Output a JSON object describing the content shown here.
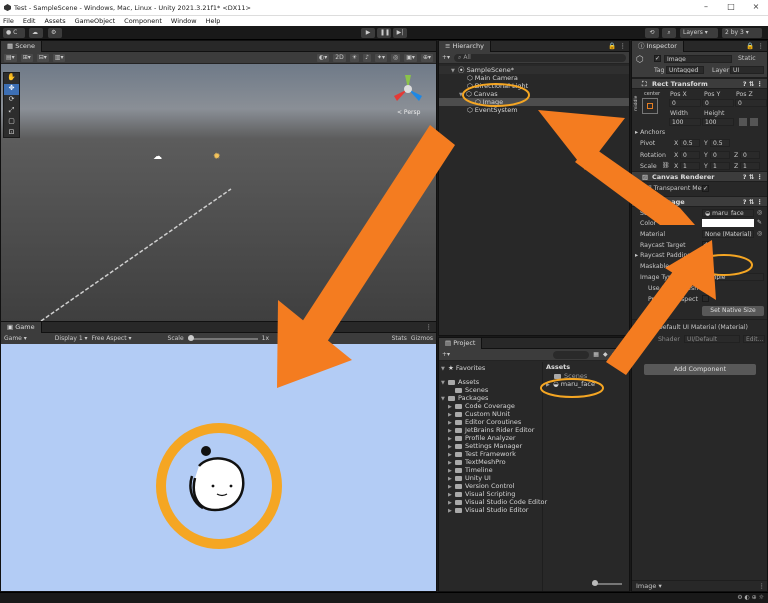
{
  "window": {
    "title": "Test - SampleScene - Windows, Mac, Linux - Unity 2021.3.21f1* <DX11>"
  },
  "menu": [
    "File",
    "Edit",
    "Assets",
    "GameObject",
    "Component",
    "Window",
    "Help"
  ],
  "toolbar": {
    "account": "C",
    "layers": "Layers",
    "layout": "2 by 3"
  },
  "scene": {
    "tab": "Scene",
    "mode_2d": "2D",
    "persp": "< Persp"
  },
  "game": {
    "tab": "Game",
    "display_mode": "Game",
    "display": "Display 1",
    "aspect": "Free Aspect",
    "scale_label": "Scale",
    "scale_value": "1x",
    "stats": "Stats",
    "gizmos": "Gizmos"
  },
  "hierarchy": {
    "tab": "Hierarchy",
    "search": "All",
    "items": [
      "SampleScene*",
      "Main Camera",
      "Directional Light",
      "Canvas",
      "Image",
      "EventSystem"
    ]
  },
  "project": {
    "tab": "Project",
    "favorites": "Favorites",
    "assets_folder": "Assets",
    "scenes": "Scenes",
    "packages": "Packages",
    "package_items": [
      "Code Coverage",
      "Custom NUnit",
      "Editor Coroutines",
      "JetBrains Rider Editor",
      "Profile Analyzer",
      "Settings Manager",
      "Test Framework",
      "TextMeshPro",
      "Timeline",
      "Unity UI",
      "Version Control",
      "Visual Scripting",
      "Visual Studio Code Editor",
      "Visual Studio Editor"
    ],
    "breadcrumb": "Assets",
    "asset_items": [
      "Scenes",
      "maru_face"
    ]
  },
  "inspector": {
    "tab": "Inspector",
    "object_name": "Image",
    "static": "Static",
    "tag_label": "Tag",
    "tag_value": "Untagged",
    "layer_label": "Layer",
    "layer_value": "UI",
    "rect_transform": {
      "title": "Rect Transform",
      "anchor": "center",
      "anchor_side": "middle",
      "pos_x_label": "Pos X",
      "pos_y_label": "Pos Y",
      "pos_z_label": "Pos Z",
      "pos_x": "0",
      "pos_y": "0",
      "pos_z": "0",
      "width_label": "Width",
      "height_label": "Height",
      "width": "100",
      "height": "100",
      "anchors": "Anchors",
      "pivot_label": "Pivot",
      "pivot_x": "0.5",
      "pivot_y": "0.5",
      "rotation_label": "Rotation",
      "rot_x": "0",
      "rot_y": "0",
      "rot_z": "0",
      "scale_label": "Scale",
      "scale_x": "1",
      "scale_y": "1",
      "scale_z": "1",
      "x": "X",
      "y": "Y",
      "z": "Z"
    },
    "canvas_renderer": {
      "title": "Canvas Renderer",
      "cull_label": "Cull Transparent Mes"
    },
    "image": {
      "title": "Image",
      "source_image_label": "Source Image",
      "source_image": "maru_face",
      "color_label": "Color",
      "material_label": "Material",
      "material": "None (Material)",
      "raycast_target_label": "Raycast Target",
      "raycast_padding_label": "Raycast Padding",
      "maskable_label": "Maskable",
      "image_type_label": "Image Type",
      "image_type": "Simple",
      "use_sprite_mesh_label": "Use Sprite Mesh",
      "preserve_aspect_label": "Preserve Aspect",
      "set_native_size": "Set Native Size"
    },
    "material_block": {
      "name": "Default UI Material (Material)",
      "shader_label": "Shader",
      "shader": "UI/Default",
      "edit": "Edit..."
    },
    "add_component": "Add Component",
    "footer": "Image"
  },
  "colors": {
    "arrow": "#f47c20",
    "highlight_ring": "#f5a623",
    "game_bg": "#b3ccf5"
  }
}
